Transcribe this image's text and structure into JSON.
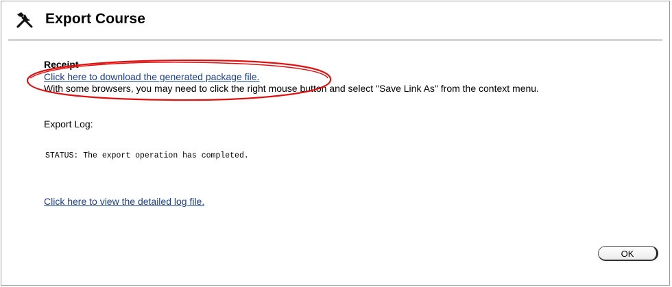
{
  "header": {
    "title": "Export Course",
    "icon": "tools-icon"
  },
  "receipt": {
    "heading": "Receipt",
    "download_link": "Click here to download the generated package file.",
    "browser_note": "With some browsers, you may need to click the right mouse button and select \"Save Link As\" from the context menu."
  },
  "log": {
    "label": "Export Log:",
    "status": "STATUS: The export operation has completed.",
    "detail_link": "Click here to view the detailed log file."
  },
  "actions": {
    "ok_label": "OK"
  },
  "colors": {
    "link": "#1a3f8f",
    "highlight": "#e01010",
    "rule": "#d4d4d4"
  }
}
